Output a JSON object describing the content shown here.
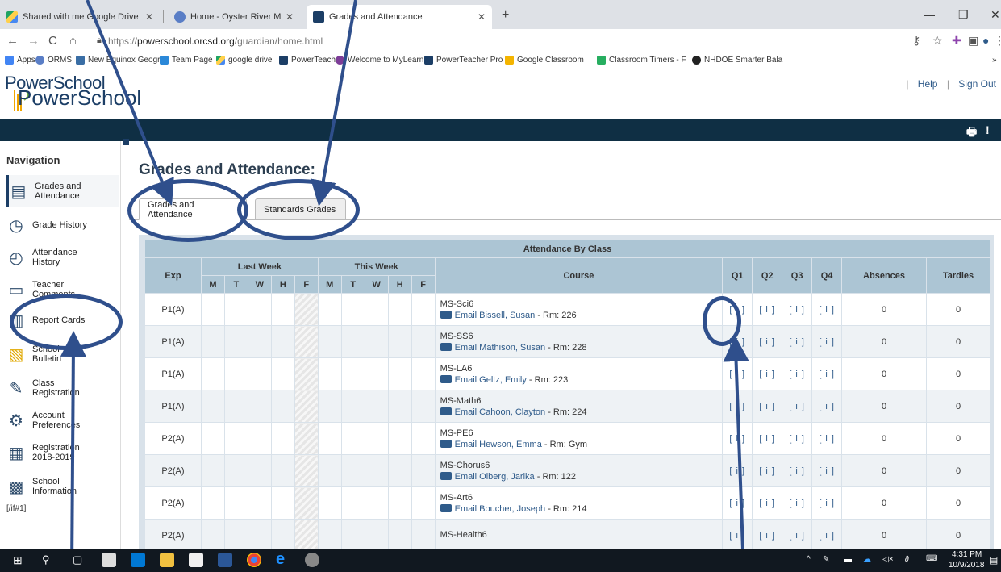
{
  "browser": {
    "tabs": [
      {
        "label": "Shared with me - Google Drive",
        "display": "Shared with me Google Drive"
      },
      {
        "label": "Home - Oyster River Middle Sch",
        "display": "Home - Oyster River Middle Scho"
      },
      {
        "label": "Grades and Attendance",
        "display": "Grades and Attendance"
      }
    ],
    "url_prefix": "https://",
    "url_host": "powerschool.orcsd.org",
    "url_path": "/guardian/home.html",
    "bookmarks": [
      "Apps",
      "ORMS",
      "New Equinox Geogra",
      "Team Page",
      "google drive",
      "PowerTeacher",
      "Welcome to MyLearn",
      "PowerTeacher Pro",
      "Google Classroom",
      "Classroom Timers - F",
      "NHDOE Smarter Bala"
    ]
  },
  "header": {
    "logo_top": "PowerSchool",
    "logo_bottom": "PowerSchool",
    "help": "Help",
    "sign_out": "Sign Out",
    "separator": "|"
  },
  "sidebar": {
    "title": "Navigation",
    "items": [
      {
        "label": "Grades and Attendance",
        "icon": "grades-icon"
      },
      {
        "label": "Grade History",
        "icon": "history-icon"
      },
      {
        "label": "Attendance History",
        "icon": "attendance-icon"
      },
      {
        "label": "Teacher Comments",
        "icon": "comments-icon"
      },
      {
        "label": "Report Cards",
        "icon": "report-icon"
      },
      {
        "label": "School Bulletin",
        "icon": "bulletin-icon"
      },
      {
        "label": "Class Registration",
        "icon": "registration-icon"
      },
      {
        "label": "Account Preferences",
        "icon": "preferences-icon"
      },
      {
        "label": "Registration 2018-2019",
        "icon": "building-icon"
      },
      {
        "label": "School Information",
        "icon": "school-icon"
      }
    ],
    "footer": "[/if#1]"
  },
  "main": {
    "title": "Grades and Attendance:",
    "tabs": [
      "Grades and Attendance",
      "Standards Grades"
    ]
  },
  "table": {
    "caption": "Attendance By Class",
    "headers": {
      "exp": "Exp",
      "last_week": "Last Week",
      "this_week": "This Week",
      "days": [
        "M",
        "T",
        "W",
        "H",
        "F"
      ],
      "course": "Course",
      "quarters": [
        "Q1",
        "Q2",
        "Q3",
        "Q4"
      ],
      "absences": "Absences",
      "tardies": "Tardies"
    },
    "rows": [
      {
        "exp": "P1(A)",
        "course": "MS-Sci6",
        "teacher": "Email Bissell, Susan",
        "room": " - Rm: 226",
        "q": [
          "[ i ]",
          "[ i ]",
          "[ i ]",
          "[ i ]"
        ],
        "absences": "0",
        "tardies": "0"
      },
      {
        "exp": "P1(A)",
        "course": "MS-SS6",
        "teacher": "Email Mathison, Susan",
        "room": " - Rm: 228",
        "q": [
          "[ i ]",
          "[ i ]",
          "[ i ]",
          "[ i ]"
        ],
        "absences": "0",
        "tardies": "0"
      },
      {
        "exp": "P1(A)",
        "course": "MS-LA6",
        "teacher": "Email Geltz, Emily",
        "room": " - Rm: 223",
        "q": [
          "[ i ]",
          "[ i ]",
          "[ i ]",
          "[ i ]"
        ],
        "absences": "0",
        "tardies": "0"
      },
      {
        "exp": "P1(A)",
        "course": "MS-Math6",
        "teacher": "Email Cahoon, Clayton",
        "room": " - Rm: 224",
        "q": [
          "[ i ]",
          "[ i ]",
          "[ i ]",
          "[ i ]"
        ],
        "absences": "0",
        "tardies": "0"
      },
      {
        "exp": "P2(A)",
        "course": "MS-PE6",
        "teacher": "Email Hewson, Emma",
        "room": " - Rm: Gym",
        "q": [
          "[ i ]",
          "[ i ]",
          "[ i ]",
          "[ i ]"
        ],
        "absences": "0",
        "tardies": "0"
      },
      {
        "exp": "P2(A)",
        "course": "MS-Chorus6",
        "teacher": "Email Olberg, Jarika",
        "room": " - Rm: 122",
        "q": [
          "[ i ]",
          "[ i ]",
          "[ i ]",
          "[ i ]"
        ],
        "absences": "0",
        "tardies": "0"
      },
      {
        "exp": "P2(A)",
        "course": "MS-Art6",
        "teacher": "Email Boucher, Joseph",
        "room": " - Rm: 214",
        "q": [
          "[ i ]",
          "[ i ]",
          "[ i ]",
          "[ i ]"
        ],
        "absences": "0",
        "tardies": "0"
      },
      {
        "exp": "P2(A)",
        "course": "MS-Health6",
        "teacher": "",
        "room": "",
        "q": [
          "[ i ]",
          "[ i ]",
          "[ i ]",
          "[ i ]"
        ],
        "absences": "0",
        "tardies": "0"
      }
    ]
  },
  "taskbar": {
    "time": "4:31 PM",
    "date": "10/9/2018"
  },
  "colors": {
    "brand_dark": "#0f2f44",
    "table_header": "#acc5d4",
    "annotation": "#2f4f8c"
  }
}
